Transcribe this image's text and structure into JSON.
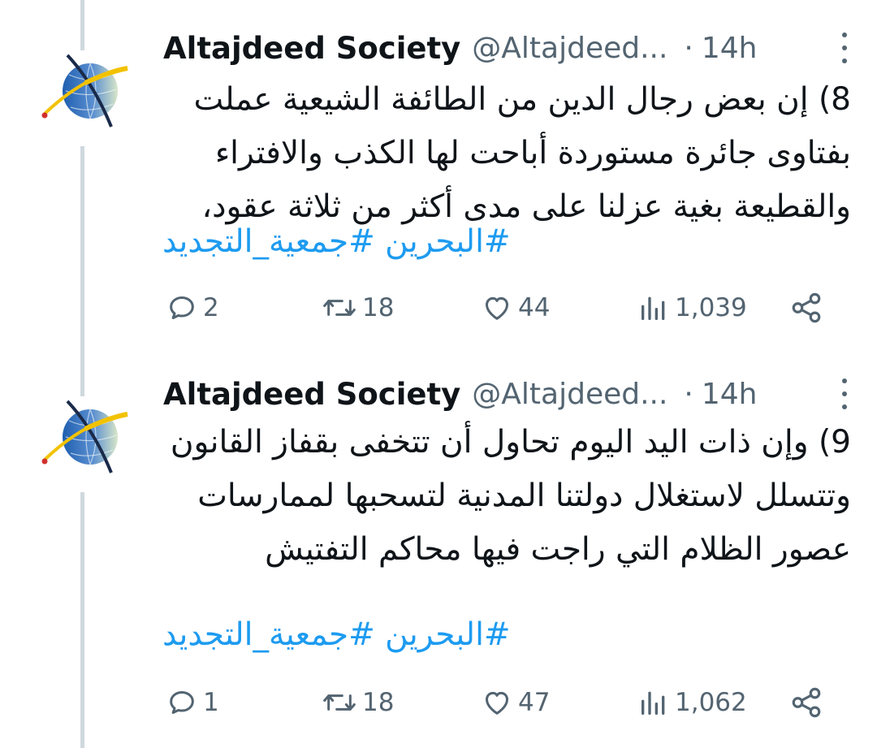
{
  "tweets": [
    {
      "author_name": "Altajdeed Society",
      "handle": "@Altajdeed...",
      "separator": "·",
      "time": "14h",
      "text": "8) إن بعض رجال الدين من الطائفة الشيعية عملت بفتاوى جائرة مستوردة أباحت لها الكذب والافتراء والقطيعة بغية عزلنا على مدى أكثر من ثلاثة عقود،",
      "hashtags": "#البحرين #جمعية_التجديد",
      "replies": "2",
      "retweets": "18",
      "likes": "44",
      "views": "1,039"
    },
    {
      "author_name": "Altajdeed Society",
      "handle": "@Altajdeed...",
      "separator": "·",
      "time": "14h",
      "text": "9) وإن ذات اليد اليوم تحاول أن تتخفى بقفاز القانون وتتسلل لاستغلال دولتنا المدنية لتسحبها لممارسات عصور الظلام التي راجت فيها محاكم التفتيش",
      "hashtags": "#البحرين #جمعية_التجديد",
      "replies": "1",
      "retweets": "18",
      "likes": "47",
      "views": "1,062"
    }
  ],
  "colors": {
    "text": "#0f1419",
    "secondary": "#536471",
    "link": "#1d9bf0",
    "thread_line": "#cfd9de",
    "logo_blue": "#1f4e9c",
    "logo_gold": "#f2c200"
  }
}
